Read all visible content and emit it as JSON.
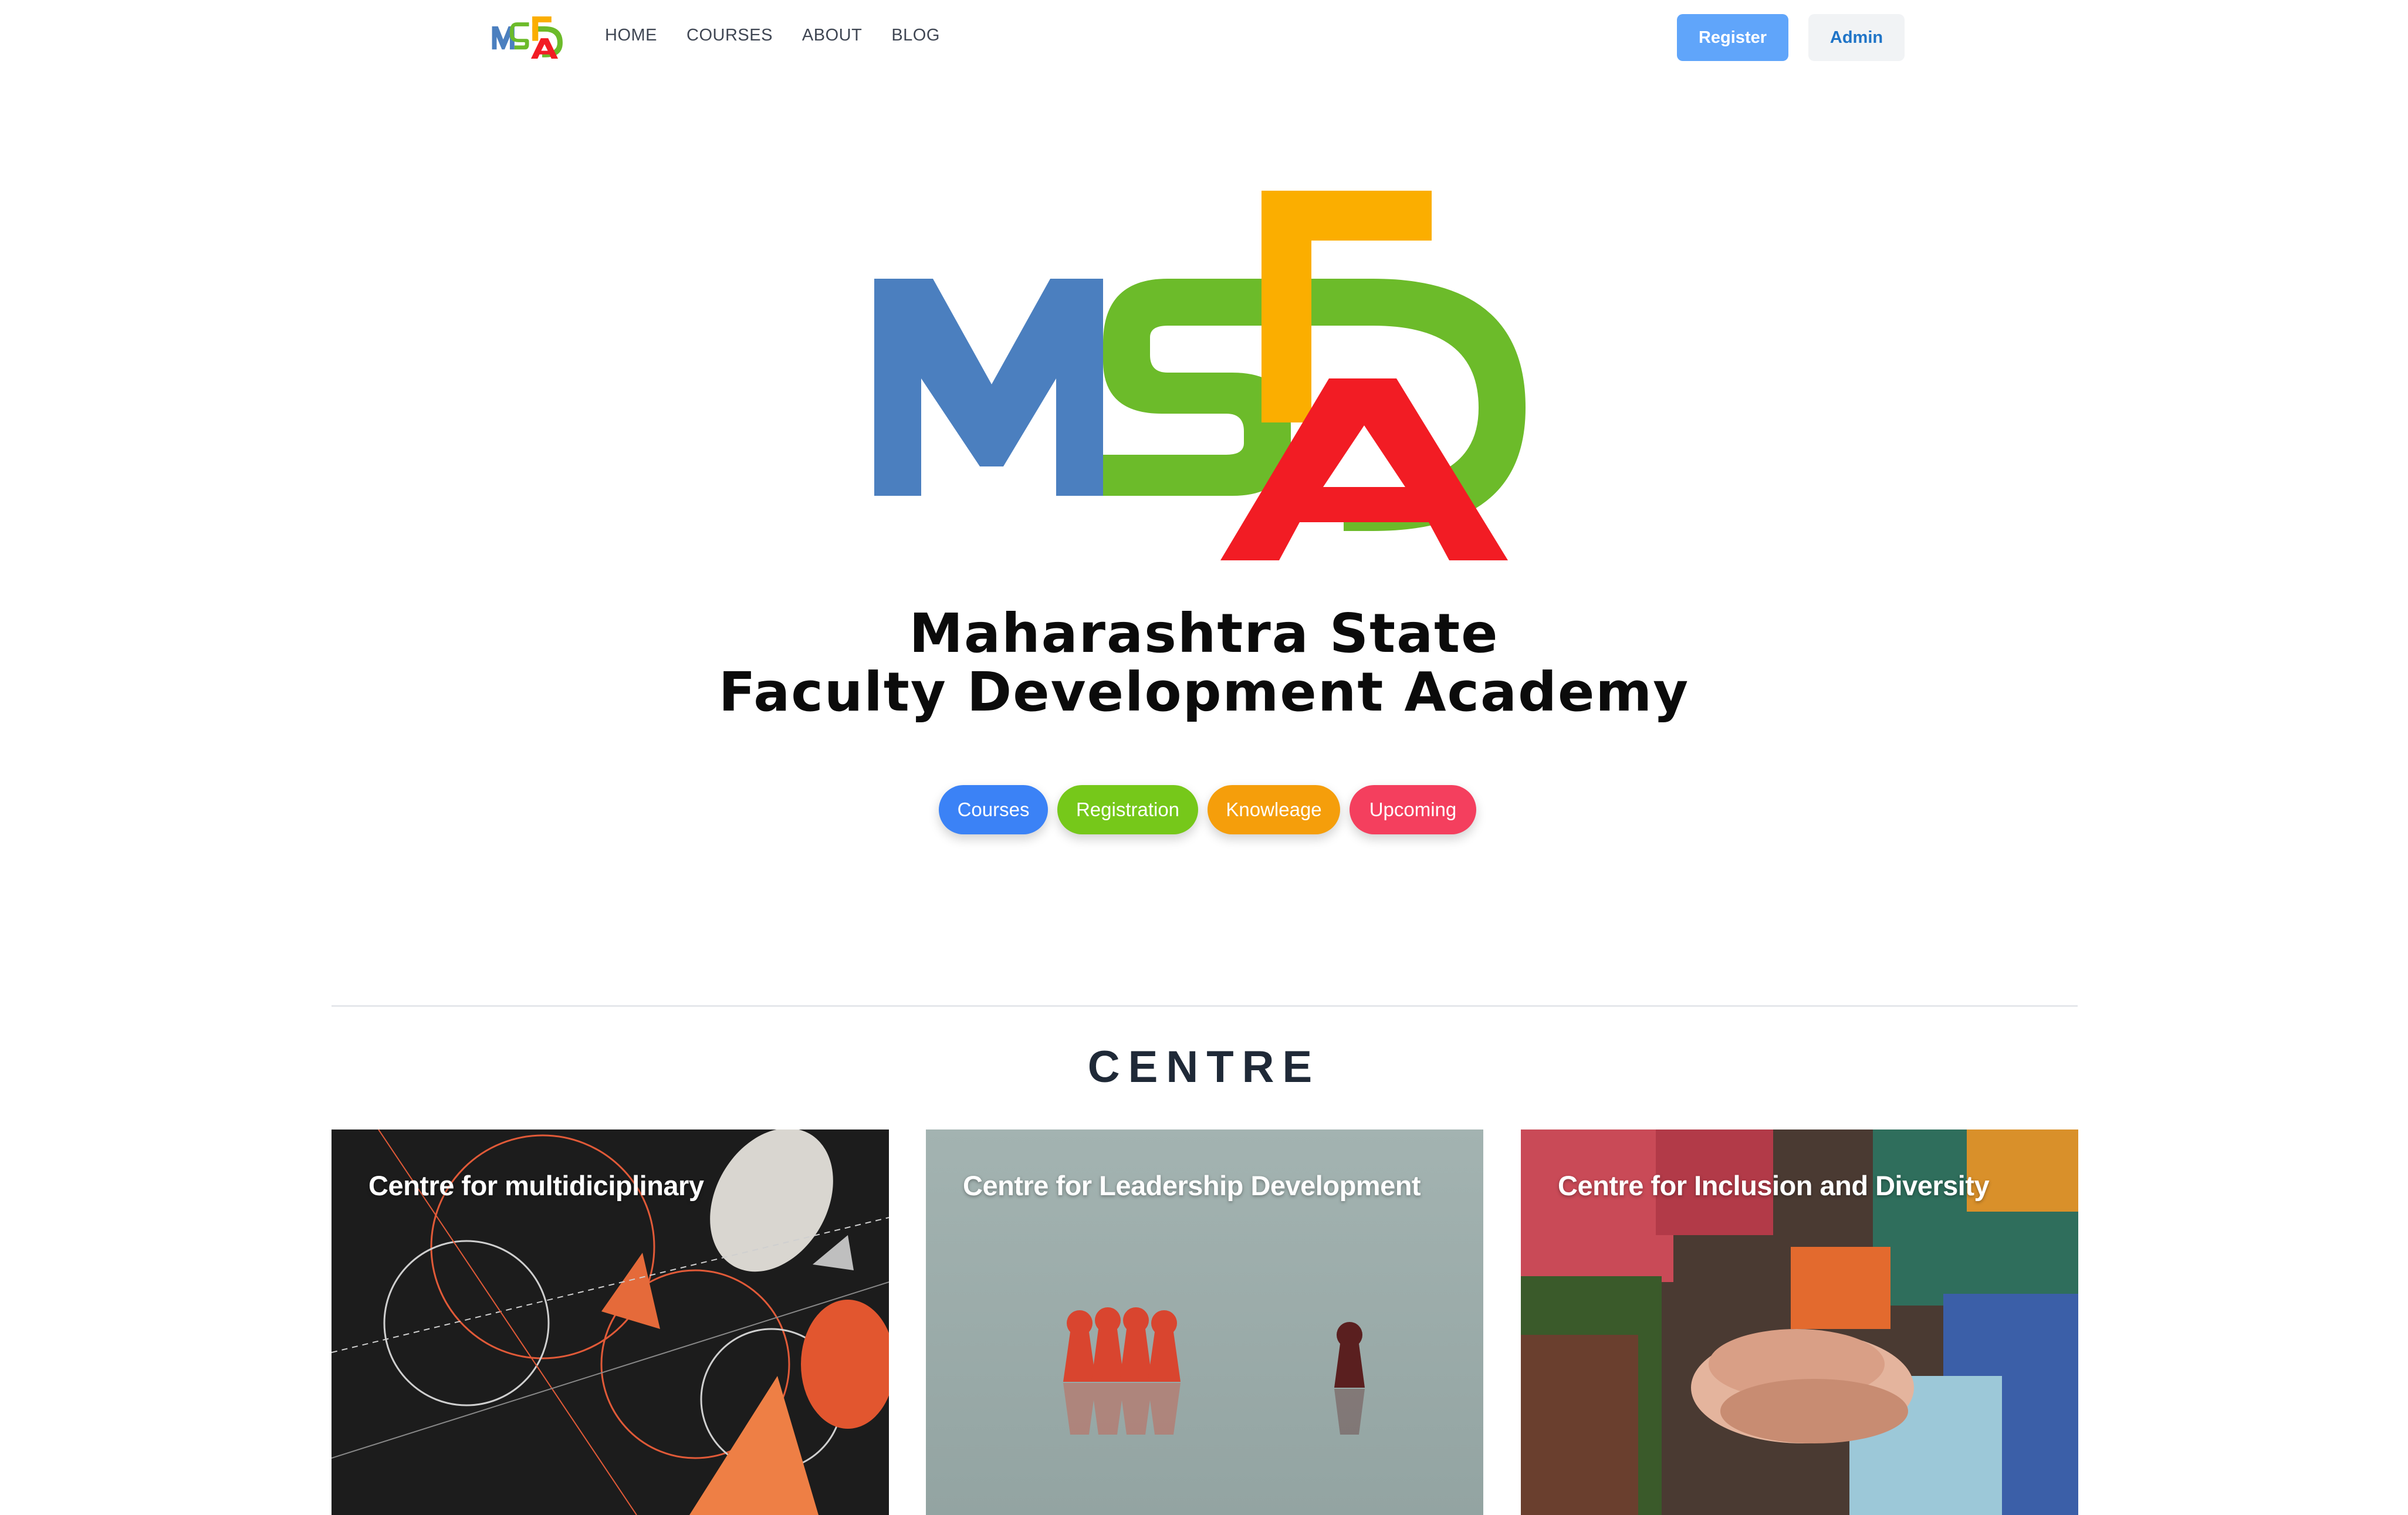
{
  "nav": {
    "logo_text": "MSFDA",
    "links": [
      "HOME",
      "COURSES",
      "ABOUT",
      "BLOG"
    ],
    "register_label": "Register",
    "admin_label": "Admin"
  },
  "hero": {
    "logo_text": "MSFDA",
    "title_line1": "Maharashtra State",
    "title_line2": "Faculty Development Academy",
    "pills": [
      {
        "label": "Courses",
        "color": "#3b82f6"
      },
      {
        "label": "Registration",
        "color": "#76c81a"
      },
      {
        "label": "Knowleage",
        "color": "#f59e0b"
      },
      {
        "label": "Upcoming",
        "color": "#f43f5e"
      }
    ]
  },
  "centre": {
    "heading": "CENTRE",
    "cards": [
      {
        "title": "Centre for multidiciplinary"
      },
      {
        "title": "Centre for Leadership Development"
      },
      {
        "title": "Centre for Inclusion and Diversity"
      }
    ]
  },
  "brand_colors": {
    "blue": "#4b7fbf",
    "green": "#6cbb2a",
    "yellow": "#fbae00",
    "red": "#f21c24"
  }
}
